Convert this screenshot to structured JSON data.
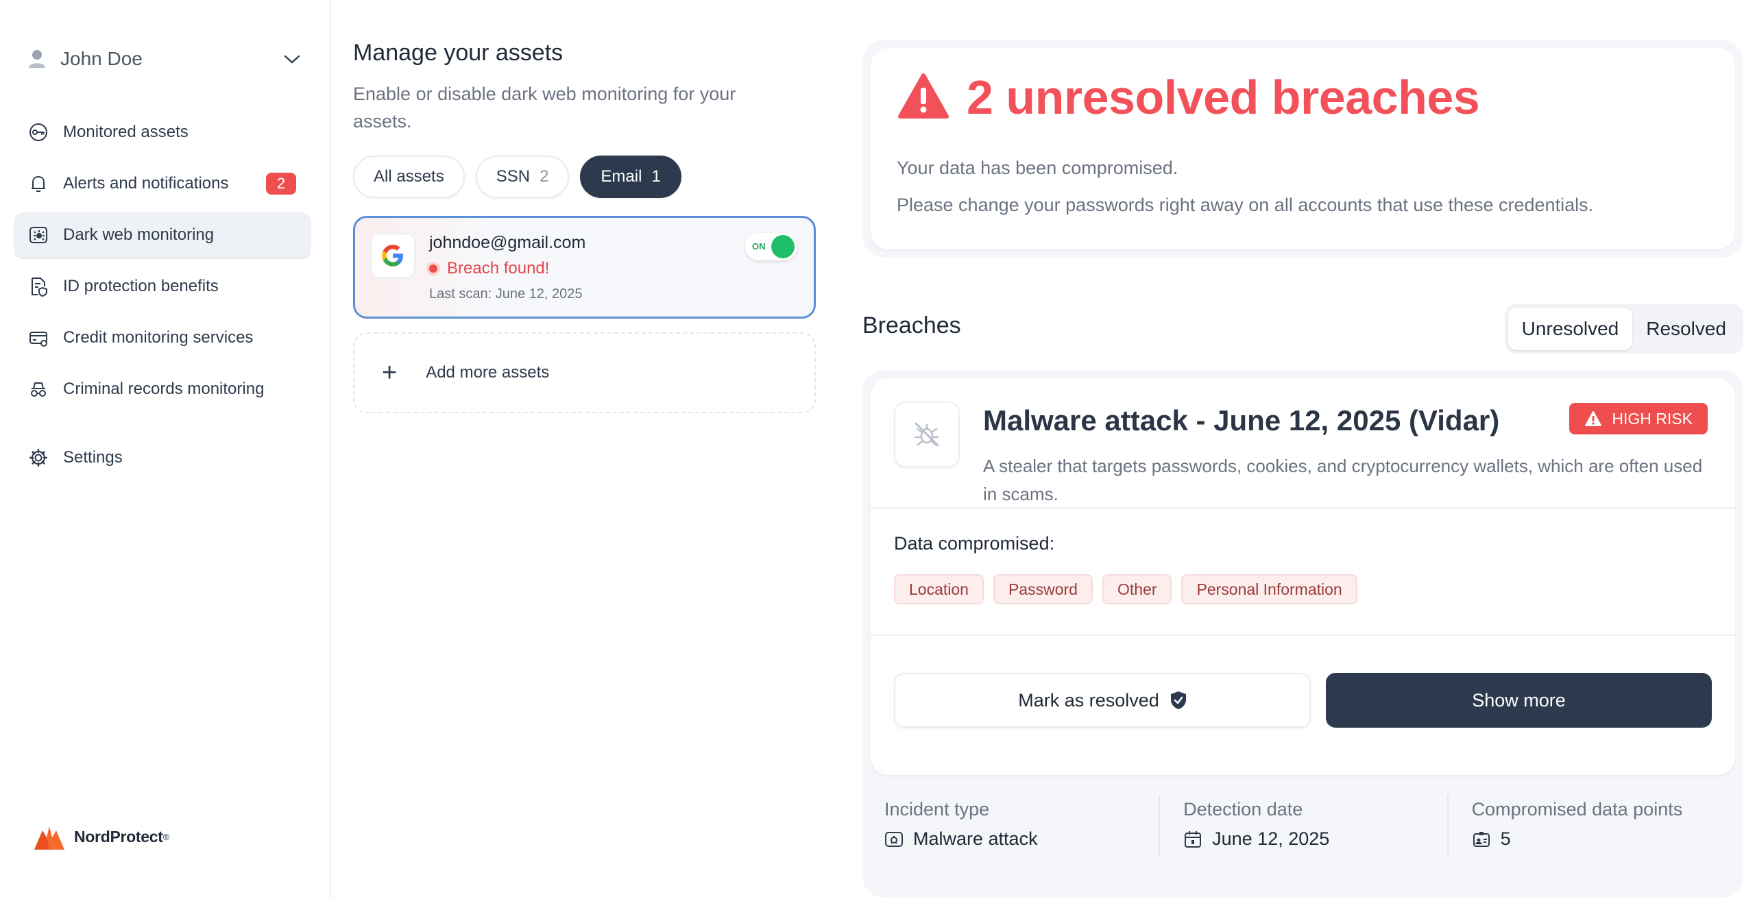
{
  "sidebar": {
    "user_name": "John Doe",
    "items": [
      {
        "label": "Monitored assets",
        "icon": "key-icon"
      },
      {
        "label": "Alerts and notifications",
        "icon": "bell-icon",
        "badge": "2"
      },
      {
        "label": "Dark web monitoring",
        "icon": "spider-icon",
        "active": true
      },
      {
        "label": "ID protection benefits",
        "icon": "document-shield-icon"
      },
      {
        "label": "Credit monitoring services",
        "icon": "credit-card-icon"
      },
      {
        "label": "Criminal records monitoring",
        "icon": "incognito-icon"
      },
      {
        "label": "Settings",
        "icon": "gear-icon"
      }
    ],
    "brand": "NordProtect",
    "brand_mark": "®"
  },
  "assets": {
    "title": "Manage your assets",
    "description": "Enable or disable dark web monitoring for your assets.",
    "filters": [
      {
        "label": "All assets",
        "count": ""
      },
      {
        "label": "SSN",
        "count": "2"
      },
      {
        "label": "Email",
        "count": "1",
        "active": true
      }
    ],
    "items": [
      {
        "email": "johndoe@gmail.com",
        "status": "Breach found!",
        "last_scan": "Last scan: June 12, 2025",
        "toggle": "ON",
        "provider_icon": "google-icon"
      }
    ],
    "add_label": "Add more assets"
  },
  "summary": {
    "headline": "2 unresolved breaches",
    "line1": "Your data has been compromised.",
    "line2": "Please change your passwords right away on all accounts that use these credentials."
  },
  "breaches": {
    "title": "Breaches",
    "tabs": [
      {
        "label": "Unresolved",
        "selected": true
      },
      {
        "label": "Resolved"
      }
    ],
    "card": {
      "title": "Malware attack - June 12, 2025 (Vidar)",
      "risk": "HIGH RISK",
      "description": "A stealer that targets passwords, cookies, and cryptocurrency wallets, which are often used in scams.",
      "compromised_label": "Data compromised:",
      "tags": [
        "Location",
        "Password",
        "Other",
        "Personal Information"
      ],
      "resolve_label": "Mark as resolved",
      "more_label": "Show more"
    },
    "meta": [
      {
        "key": "Incident type",
        "value": "Malware attack",
        "icon": "bug-icon"
      },
      {
        "key": "Detection date",
        "value": "June 12, 2025",
        "icon": "calendar-icon"
      },
      {
        "key": "Compromised data points",
        "value": "5",
        "icon": "id-card-icon"
      }
    ]
  },
  "colors": {
    "danger": "#f2515a",
    "dark": "#2d3a4d",
    "success": "#1fbf6a",
    "accent_border": "#5b8fd6"
  }
}
